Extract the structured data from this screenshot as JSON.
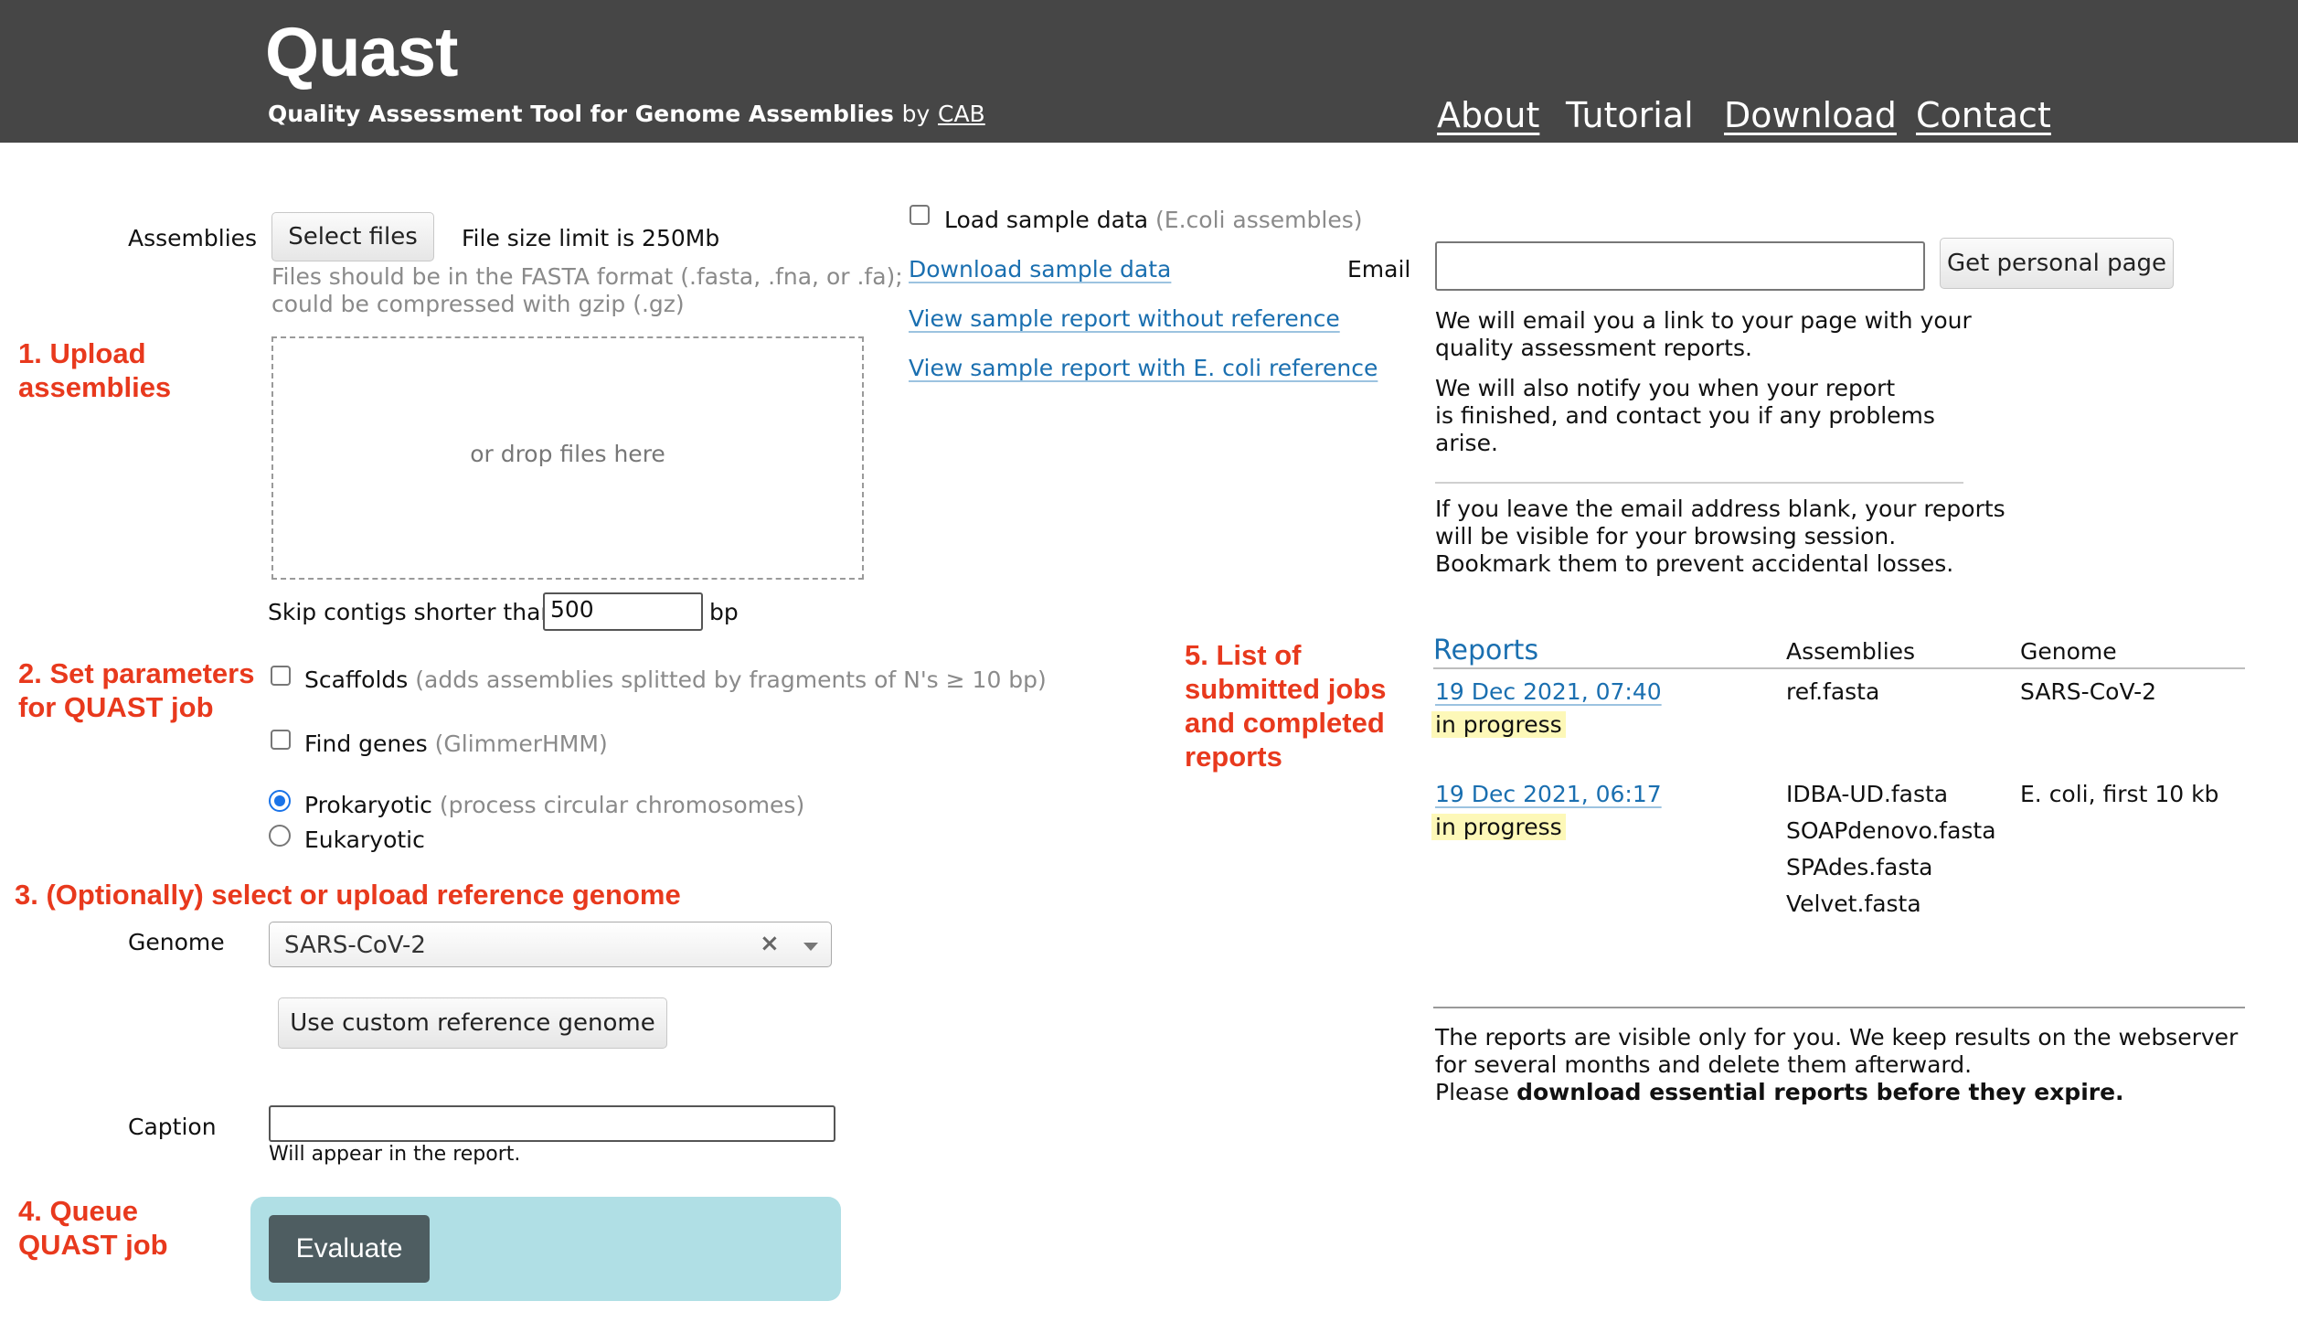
{
  "header": {
    "logo": "Quast",
    "tagline": "Quality Assessment Tool for Genome Assemblies",
    "by": "by",
    "cab": "CAB",
    "nav": [
      "About",
      "Tutorial",
      "Download",
      "Contact"
    ]
  },
  "annotations": {
    "step1": "1. Upload assemblies",
    "step2": "2. Set parameters for QUAST job",
    "step3": "3. (Optionally) select or upload reference genome",
    "step4": "4. Queue QUAST job",
    "step5": "5. List of submitted jobs and completed reports"
  },
  "upload": {
    "label": "Assemblies",
    "select_button": "Select files",
    "size_limit": "File size limit is 250Mb",
    "hint_line1": "Files should be in the FASTA format (.fasta, .fna, or .fa);",
    "hint_line2": "could be compressed with gzip (.gz)",
    "drop_text": "or drop files here"
  },
  "params": {
    "skip_label": "Skip contigs shorter than",
    "skip_value": "500",
    "skip_unit": "bp",
    "scaffolds_label": "Scaffolds",
    "scaffolds_hint": "(adds assemblies splitted by fragments of N's ≥ 10 bp)",
    "find_genes_label": "Find genes",
    "find_genes_hint": "(GlimmerHMM)",
    "prokaryotic_label": "Prokaryotic",
    "prokaryotic_hint": "(process circular chromosomes)",
    "eukaryotic_label": "Eukaryotic"
  },
  "reference": {
    "genome_label": "Genome",
    "genome_value": "SARS-CoV-2",
    "custom_button": "Use custom reference genome"
  },
  "caption": {
    "label": "Caption",
    "value": "",
    "hint": "Will appear in the report."
  },
  "submit": {
    "evaluate_button": "Evaluate"
  },
  "sample": {
    "load_label": "Load sample data",
    "load_hint": "(E.coli assembles)",
    "download_link": "Download sample data",
    "report_no_ref": "View sample report without reference",
    "report_ecoli": "View sample report with E. coli reference"
  },
  "email": {
    "label": "Email",
    "value": "",
    "button": "Get personal page",
    "info1_line1": "We will email you a link to your page with your",
    "info1_line2": "quality assessment reports.",
    "info2_line1": "We will also notify you when your report",
    "info2_line2": "is finished, and contact you if any problems",
    "info2_line3": "arise.",
    "info3_line1": "If you leave the email address blank, your reports",
    "info3_line2": "will be visible for your browsing session.",
    "info3_line3": "Bookmark them to prevent accidental losses."
  },
  "reports": {
    "headers": [
      "Reports",
      "Assemblies",
      "Genome"
    ],
    "rows": [
      {
        "date": "19 Dec 2021, 07:40",
        "status": "in progress",
        "assemblies": [
          "ref.fasta"
        ],
        "genome": "SARS-CoV-2"
      },
      {
        "date": "19 Dec 2021, 06:17",
        "status": "in progress",
        "assemblies": [
          "IDBA-UD.fasta",
          "SOAPdenovo.fasta",
          "SPAdes.fasta",
          "Velvet.fasta"
        ],
        "genome": "E. coli, first 10 kb"
      }
    ],
    "footer_line1": "The reports are visible only for you. We keep results on the webserver",
    "footer_line2": "for several months and delete them afterward.",
    "footer_line3_prefix": "Please",
    "footer_line3_bold": "download essential reports before they expire."
  },
  "colors": {
    "header_bg": "#464646",
    "annotation_red": "#e8391d",
    "link_blue": "#1a6fb0",
    "evaluate_panel": "#b0dfe5",
    "evaluate_button": "#4e5d61",
    "highlight_yellow": "#fdf8b8"
  }
}
